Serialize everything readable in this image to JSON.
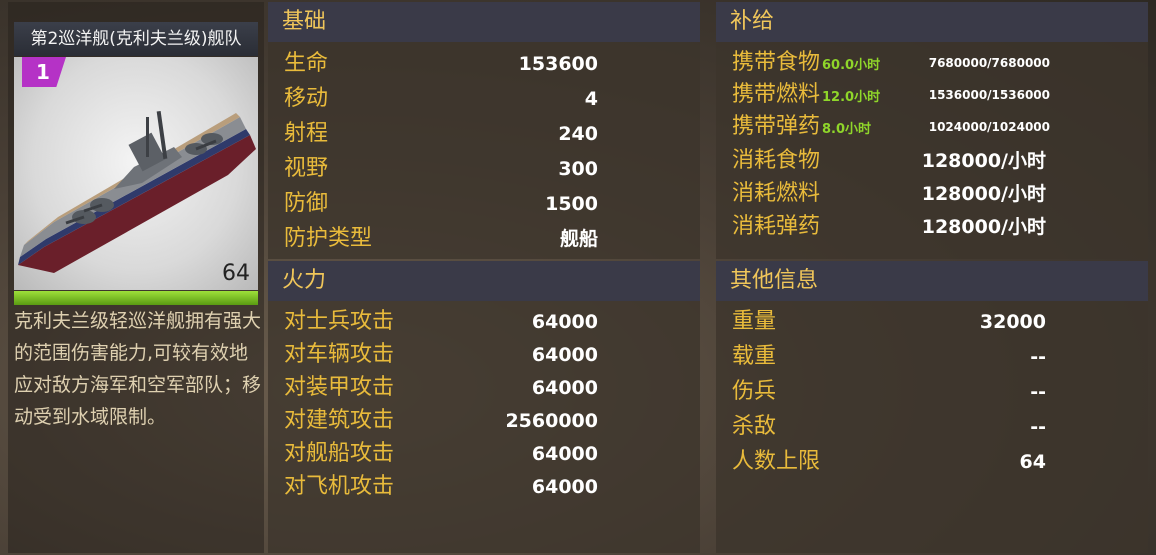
{
  "unit": {
    "title": "第2巡洋舰(克利夫兰级)舰队",
    "tier": "1",
    "level": "64",
    "level_progress": 1.0,
    "description": "克利夫兰级轻巡洋舰拥有强大的范围伤害能力,可较有效地应对敌方海军和空军部队；移动受到水域限制。"
  },
  "basic": {
    "header": "基础",
    "rows": [
      {
        "label": "生命",
        "value": "153600"
      },
      {
        "label": "移动",
        "value": "4"
      },
      {
        "label": "射程",
        "value": "240"
      },
      {
        "label": "视野",
        "value": "300"
      },
      {
        "label": "防御",
        "value": "1500"
      },
      {
        "label": "防护类型",
        "value": "舰船"
      }
    ]
  },
  "firepower": {
    "header": "火力",
    "rows": [
      {
        "label": "对士兵攻击",
        "value": "64000"
      },
      {
        "label": "对车辆攻击",
        "value": "64000"
      },
      {
        "label": "对装甲攻击",
        "value": "64000"
      },
      {
        "label": "对建筑攻击",
        "value": "2560000"
      },
      {
        "label": "对舰船攻击",
        "value": "64000"
      },
      {
        "label": "对飞机攻击",
        "value": "64000"
      }
    ]
  },
  "supply": {
    "header": "补给",
    "carry": [
      {
        "label": "携带食物",
        "hours": "60.0小时",
        "capacity": "7680000/7680000"
      },
      {
        "label": "携带燃料",
        "hours": "12.0小时",
        "capacity": "1536000/1536000"
      },
      {
        "label": "携带弹药",
        "hours": "8.0小时",
        "capacity": "1024000/1024000"
      }
    ],
    "consume": [
      {
        "label": "消耗食物",
        "value": "128000/小时"
      },
      {
        "label": "消耗燃料",
        "value": "128000/小时"
      },
      {
        "label": "消耗弹药",
        "value": "128000/小时"
      }
    ]
  },
  "other": {
    "header": "其他信息",
    "rows": [
      {
        "label": "重量",
        "value": "32000"
      },
      {
        "label": "载重",
        "value": "--"
      },
      {
        "label": "伤兵",
        "value": "--"
      },
      {
        "label": "杀敌",
        "value": "--"
      },
      {
        "label": "人数上限",
        "value": "64"
      }
    ]
  },
  "colors": {
    "label": "#e9bb3b",
    "header_text": "#f0c65a",
    "hours": "#8fd62a",
    "tier_badge": "#b532c6",
    "level_bar": "#7fc226"
  }
}
